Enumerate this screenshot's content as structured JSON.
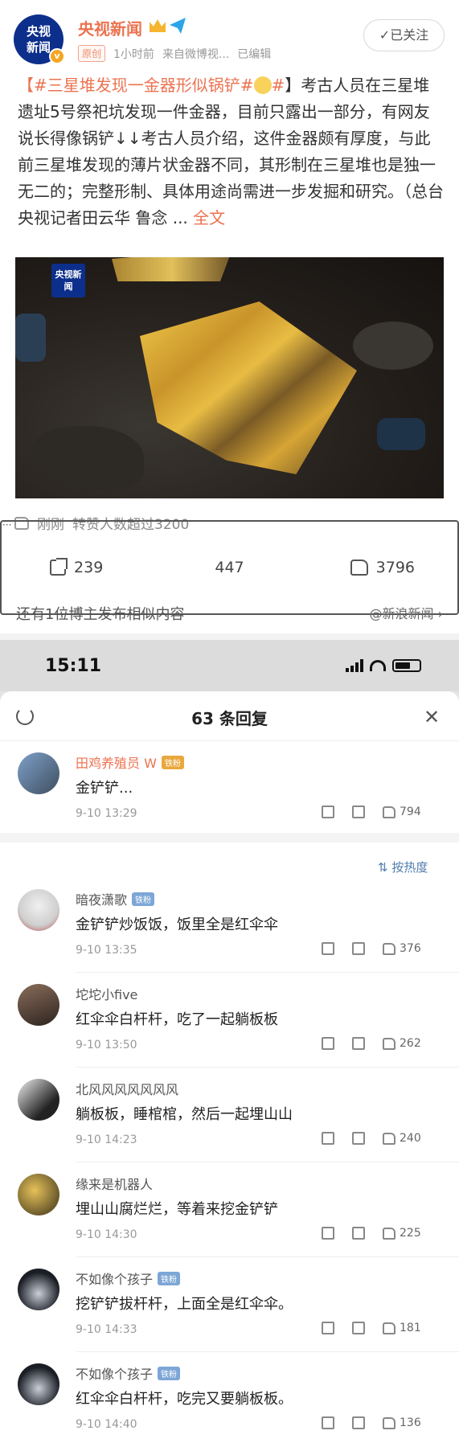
{
  "post": {
    "avatar_text": "央视新闻",
    "author": "央视新闻",
    "original_tag": "原创",
    "time": "1小时前",
    "source": "来自微博视...",
    "edited": "已编辑",
    "follow_label": "✓已关注",
    "hashtag": "【#三星堆发现一金器形似锅铲#",
    "text_after_tag": "】考古人员在三星堆遗址5号祭祀坑发现一件金器，目前只露出一部分，有网友说长得像锅铲↓↓考古人员介绍，这件金器颇有厚度，与此前三星堆发现的薄片状金器不同，其形制在三星堆也是独一无二的；完整形制、具体用途尚需进一步发掘和研究。（总台央视记者田云华 鲁念 ...",
    "more_label": "全文",
    "photo_watermark": "央视新闻",
    "repost_note_time": "刚刚",
    "repost_note": "转赞人数超过3200",
    "shares": "239",
    "comments": "447",
    "likes": "3796",
    "similar_text": "还有1位博主发布相似内容",
    "similar_source": "@新浪新闻 ›"
  },
  "status_bar": {
    "time": "15:11"
  },
  "sheet": {
    "title": "63 条回复",
    "sort_label": "按热度"
  },
  "pinned_comment": {
    "name": "田鸡养殖员 W",
    "badge": "铁粉",
    "text": "金铲铲...",
    "time": "9-10 13:29",
    "likes": "794"
  },
  "comments": [
    {
      "name": "暗夜潇歌",
      "badge": "铁粉",
      "text": "金铲铲炒饭饭，饭里全是红伞伞",
      "time": "9-10 13:35",
      "likes": "376"
    },
    {
      "name": "坨坨小five",
      "badge": "",
      "text": "红伞伞白杆杆，吃了一起躺板板",
      "time": "9-10 13:50",
      "likes": "262"
    },
    {
      "name": "北风风风风风风风",
      "badge": "",
      "text": "躺板板，睡棺棺，然后一起埋山山",
      "time": "9-10 14:23",
      "likes": "240"
    },
    {
      "name": "缘来是机器人",
      "badge": "",
      "text": "埋山山腐烂烂，等着来挖金铲铲",
      "time": "9-10 14:30",
      "likes": "225"
    },
    {
      "name": "不如像个孩子",
      "badge": "铁粉",
      "text": "挖铲铲拔杆杆，上面全是红伞伞。",
      "time": "9-10 14:33",
      "likes": "181"
    },
    {
      "name": "不如像个孩子",
      "badge": "铁粉",
      "text": "红伞伞白杆杆，吃完又要躺板板。",
      "time": "9-10 14:40",
      "likes": "136"
    }
  ],
  "colors": {
    "accent": "#eb7350",
    "link": "#507daf"
  }
}
